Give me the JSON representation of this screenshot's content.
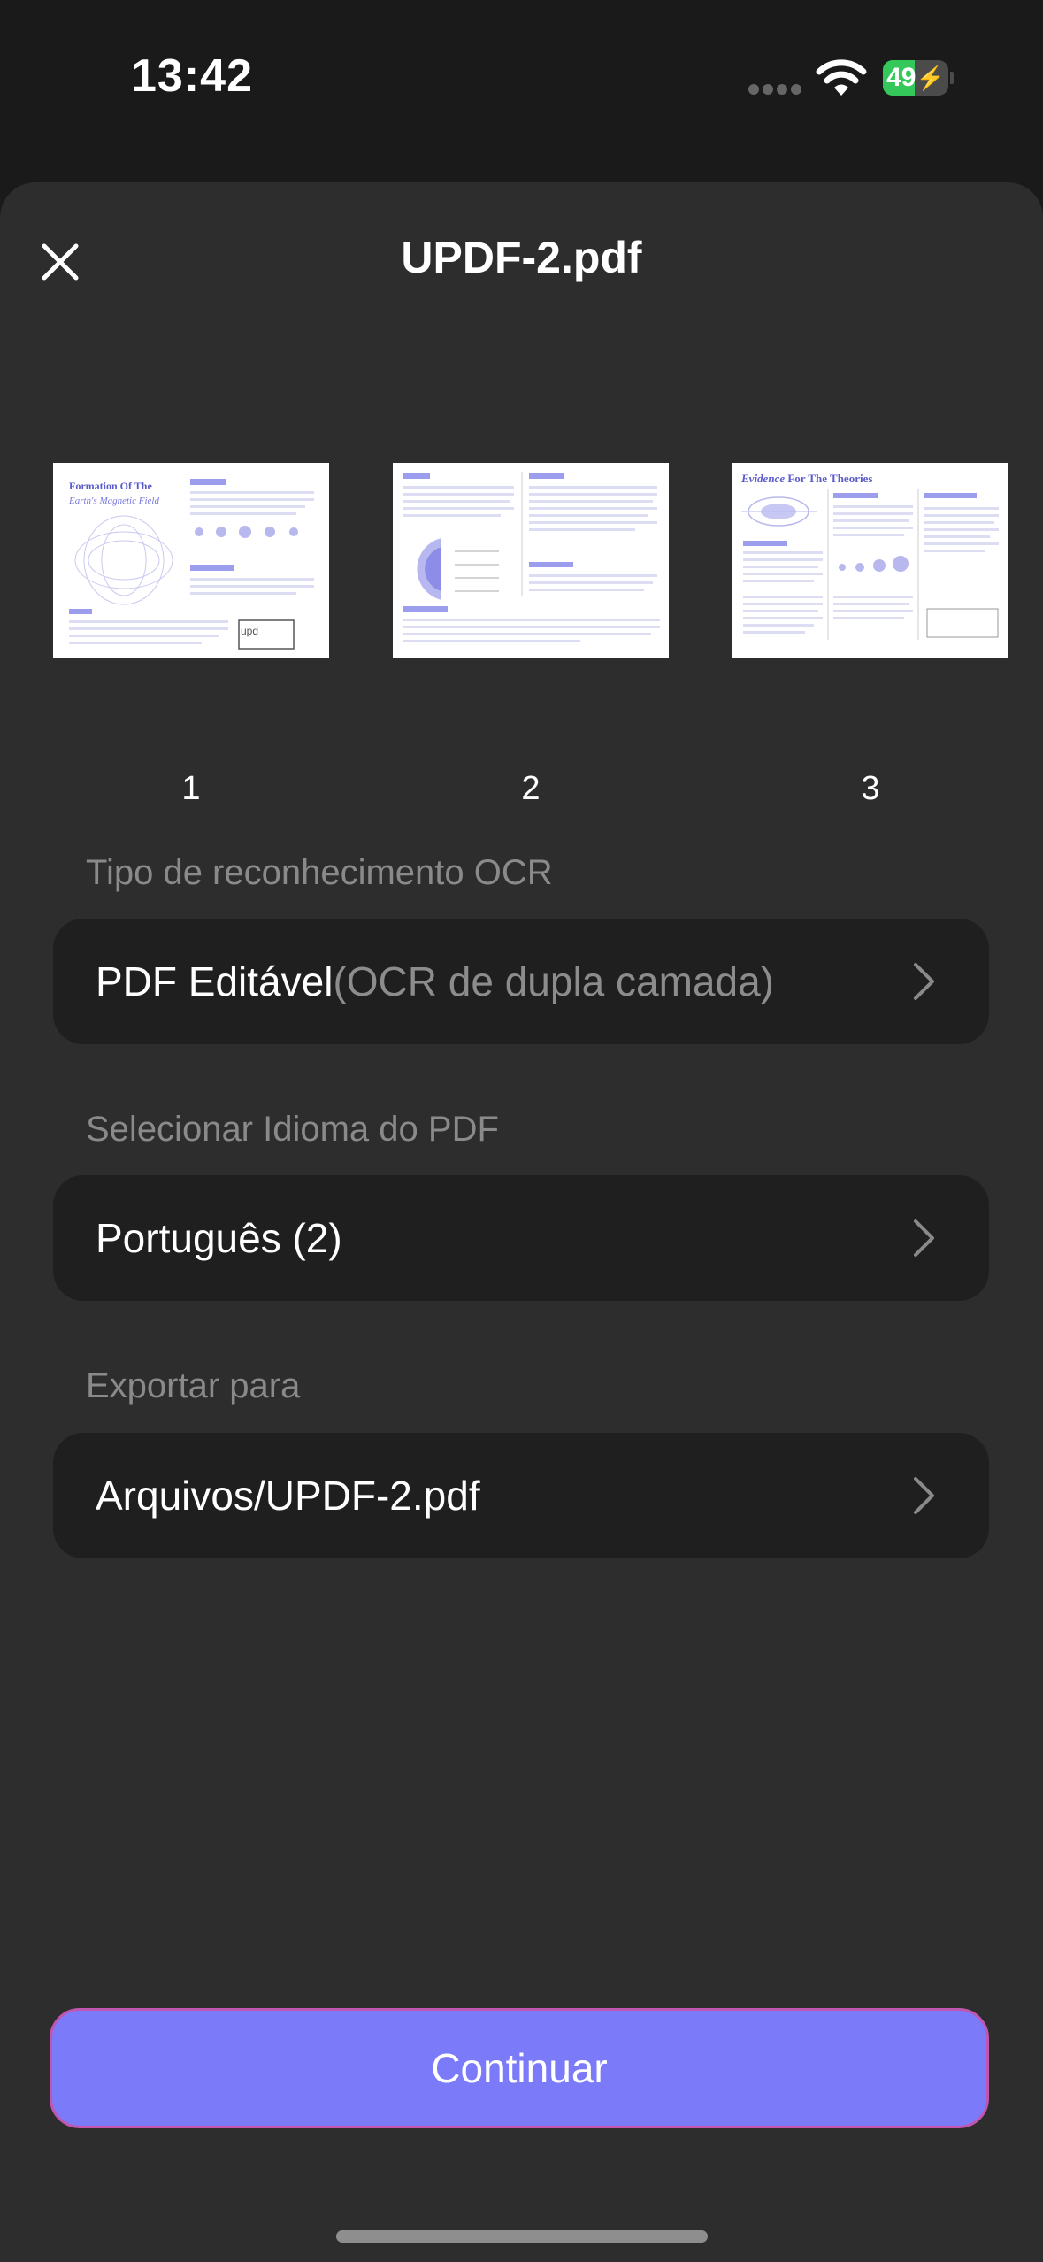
{
  "status_bar": {
    "time": "13:42",
    "battery": "49",
    "battery_level": 0.49
  },
  "header": {
    "title": "UPDF-2.pdf",
    "close_icon": "close-icon"
  },
  "pages": [
    {
      "number": "1",
      "heading_line1": "Formation Of The",
      "heading_line2": "Earth's Magnetic Field"
    },
    {
      "number": "2"
    },
    {
      "number": "3",
      "heading_part1": "Evidence",
      "heading_part2": "For The Theories"
    }
  ],
  "ocr_type": {
    "label": "Tipo de reconhecimento OCR",
    "value": "PDF Editável",
    "value_detail": "(OCR de dupla camada)"
  },
  "language": {
    "label": "Selecionar Idioma do PDF",
    "value": "Português (2)"
  },
  "export": {
    "label": "Exportar para",
    "value": "Arquivos/UPDF-2.pdf"
  },
  "continue_button": {
    "label": "Continuar"
  },
  "colors": {
    "accent": "#7b7bfa",
    "sheet": "#2d2d2d",
    "row": "#1f1f1f",
    "battery": "#34c759"
  }
}
